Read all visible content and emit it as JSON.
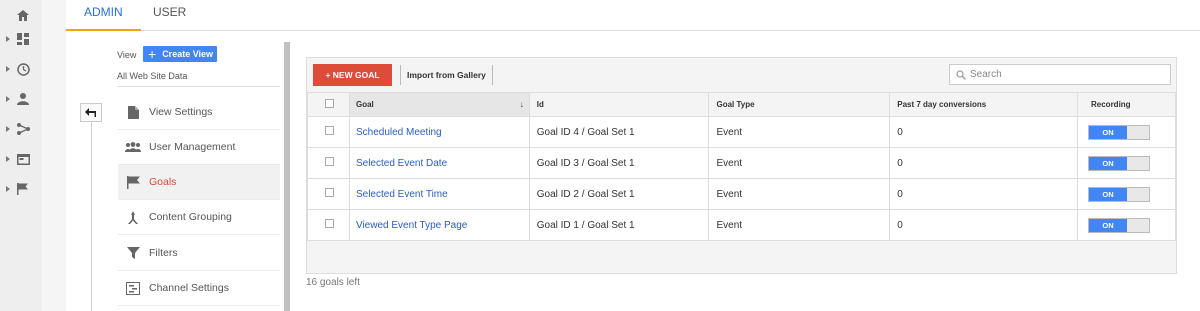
{
  "tabs": [
    {
      "label": "ADMIN",
      "active": true
    },
    {
      "label": "USER",
      "active": false
    }
  ],
  "left_rail": [
    "home-icon",
    "dashboard-icon",
    "clock-icon",
    "person-icon",
    "acquisition-icon",
    "behavior-icon",
    "flag-icon"
  ],
  "view": {
    "label": "View",
    "create_label": "Create View",
    "name": "All Web Site Data"
  },
  "nav_items": [
    {
      "label": "View Settings",
      "icon": "document-icon",
      "active": false
    },
    {
      "label": "User Management",
      "icon": "people-icon",
      "active": false
    },
    {
      "label": "Goals",
      "icon": "flag-icon",
      "active": true
    },
    {
      "label": "Content Grouping",
      "icon": "grouping-icon",
      "active": false
    },
    {
      "label": "Filters",
      "icon": "filter-icon",
      "active": false
    },
    {
      "label": "Channel Settings",
      "icon": "channel-icon",
      "active": false
    }
  ],
  "toolbar": {
    "new_goal_label": "+ NEW GOAL",
    "import_label": "Import from Gallery",
    "search_placeholder": "Search"
  },
  "table": {
    "headers": [
      "Goal",
      "Id",
      "Goal Type",
      "Past 7 day conversions",
      "Recording"
    ],
    "rows": [
      {
        "goal": "Scheduled Meeting",
        "id": "Goal ID 4 / Goal Set 1",
        "type": "Event",
        "conversions": "0",
        "recording": "ON"
      },
      {
        "goal": "Selected Event Date",
        "id": "Goal ID 3 / Goal Set 1",
        "type": "Event",
        "conversions": "0",
        "recording": "ON"
      },
      {
        "goal": "Selected Event Time",
        "id": "Goal ID 2 / Goal Set 1",
        "type": "Event",
        "conversions": "0",
        "recording": "ON"
      },
      {
        "goal": "Viewed Event Type Page",
        "id": "Goal ID 1 / Goal Set 1",
        "type": "Event",
        "conversions": "0",
        "recording": "ON"
      }
    ]
  },
  "footer": {
    "goals_left": "16 goals left"
  },
  "colors": {
    "accent": "#4285f4",
    "danger": "#dd4b39",
    "tab_underline": "#f0a500",
    "link": "#2a5cc6"
  }
}
